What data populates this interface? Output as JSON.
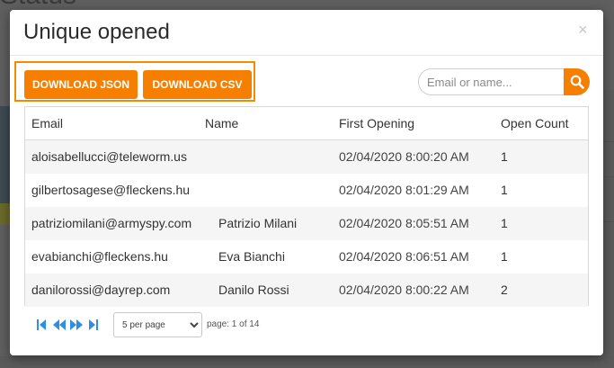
{
  "background": {
    "title_fragment": "Status"
  },
  "modal": {
    "title": "Unique opened",
    "close_glyph": "×"
  },
  "toolbar": {
    "download_json_label": "DOWNLOAD JSON",
    "download_csv_label": "DOWNLOAD CSV",
    "search_placeholder": "Email or name...",
    "search_value": ""
  },
  "table": {
    "headers": [
      "Email",
      "Name",
      "First Opening",
      "Open Count"
    ],
    "rows": [
      {
        "email": "aloisabellucci@teleworm.us",
        "name": "",
        "first_opening": "02/04/2020 8:00:20 AM",
        "open_count": "1"
      },
      {
        "email": "gilbertosagese@fleckens.hu",
        "name": "",
        "first_opening": "02/04/2020 8:01:29 AM",
        "open_count": "1"
      },
      {
        "email": "patriziomilani@armyspy.com",
        "name": "Patrizio Milani",
        "first_opening": "02/04/2020 8:05:51 AM",
        "open_count": "1"
      },
      {
        "email": "evabianchi@fleckens.hu",
        "name": "Eva Bianchi",
        "first_opening": "02/04/2020 8:06:51 AM",
        "open_count": "1"
      },
      {
        "email": "danilorossi@dayrep.com",
        "name": "Danilo Rossi",
        "first_opening": "02/04/2020 8:00:22 AM",
        "open_count": "2"
      }
    ]
  },
  "pagination": {
    "per_page_selected": "5 per page",
    "page_info": "page: 1 of 14"
  },
  "colors": {
    "accent": "#f77f00",
    "pager_icon": "#2f8de4"
  }
}
